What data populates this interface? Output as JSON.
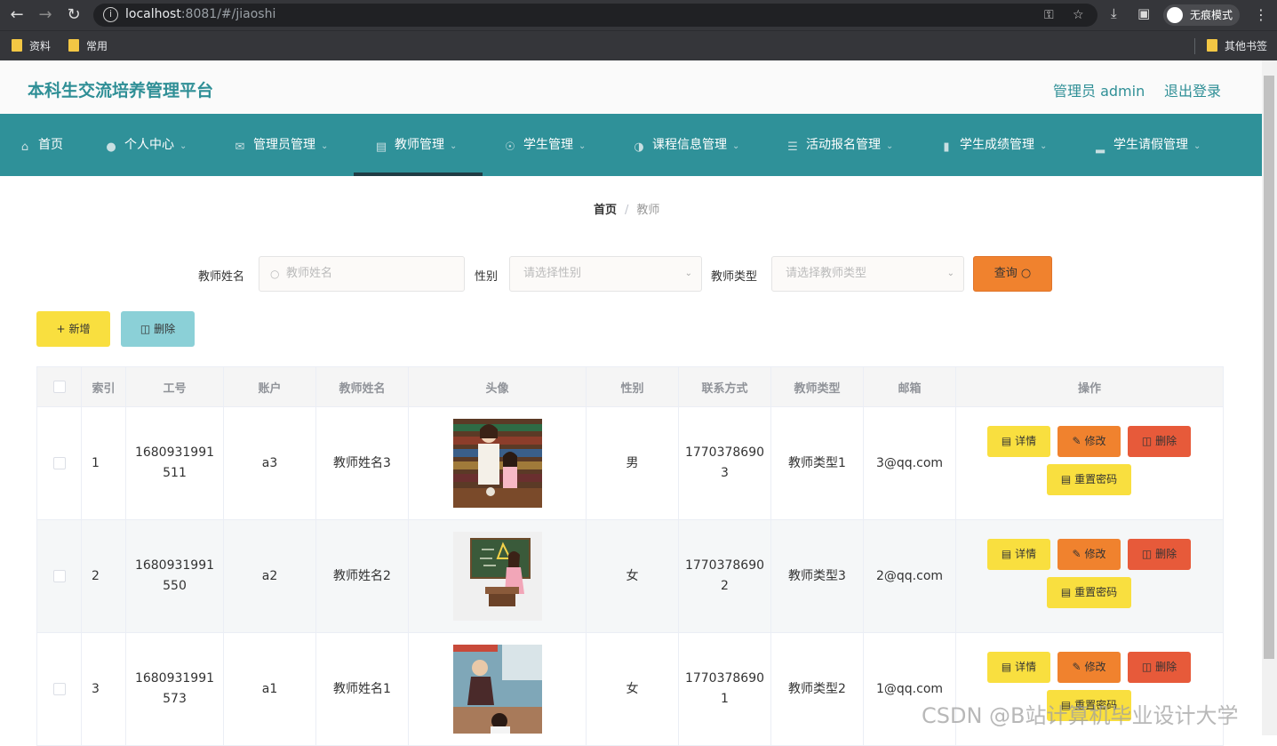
{
  "browser": {
    "url_host": "localhost",
    "url_rest": ":8081/#/jiaoshi",
    "incognito_label": "无痕模式",
    "bookmarks": [
      "资料",
      "常用"
    ],
    "other_bookmarks": "其他书签"
  },
  "header": {
    "title": "本科生交流培养管理平台",
    "admin": "管理员 admin",
    "logout": "退出登录"
  },
  "menu": [
    {
      "label": "首页",
      "icon": "home-icon"
    },
    {
      "label": "个人中心",
      "icon": "user-icon"
    },
    {
      "label": "管理员管理",
      "icon": "mail-icon"
    },
    {
      "label": "教师管理",
      "icon": "briefcase-icon"
    },
    {
      "label": "学生管理",
      "icon": "compass-icon"
    },
    {
      "label": "课程信息管理",
      "icon": "microphone-icon"
    },
    {
      "label": "活动报名管理",
      "icon": "list-icon"
    },
    {
      "label": "学生成绩管理",
      "icon": "chat-icon"
    },
    {
      "label": "学生请假管理",
      "icon": "bar-chart-icon"
    }
  ],
  "breadcrumb": {
    "home": "首页",
    "sep": "/",
    "current": "教师"
  },
  "search": {
    "name_label": "教师姓名",
    "name_placeholder": "教师姓名",
    "gender_label": "性别",
    "gender_placeholder": "请选择性别",
    "type_label": "教师类型",
    "type_placeholder": "请选择教师类型",
    "query_label": "查询"
  },
  "actions": {
    "add_label": "新增",
    "delete_label": "删除"
  },
  "table": {
    "headers": [
      "索引",
      "工号",
      "账户",
      "教师姓名",
      "头像",
      "性别",
      "联系方式",
      "教师类型",
      "邮箱",
      "操作"
    ],
    "rows": [
      {
        "index": "1",
        "id": "1680931991511",
        "id_l1": "1680931991",
        "id_l2": "511",
        "account": "a3",
        "name": "教师姓名3",
        "gender": "男",
        "phone_l1": "1770378690",
        "phone_l2": "3",
        "type": "教师类型1",
        "email": "3@qq.com"
      },
      {
        "index": "2",
        "id": "1680931991550",
        "id_l1": "1680931991",
        "id_l2": "550",
        "account": "a2",
        "name": "教师姓名2",
        "gender": "女",
        "phone_l1": "1770378690",
        "phone_l2": "2",
        "type": "教师类型3",
        "email": "2@qq.com"
      },
      {
        "index": "3",
        "id": "1680931991573",
        "id_l1": "1680931991",
        "id_l2": "573",
        "account": "a1",
        "name": "教师姓名1",
        "gender": "女",
        "phone_l1": "1770378690",
        "phone_l2": "1",
        "type": "教师类型2",
        "email": "1@qq.com"
      }
    ],
    "ops": {
      "detail": "详情",
      "edit": "修改",
      "remove": "删除",
      "reset": "重置密码"
    }
  },
  "watermark": "CSDN @B站计算机毕业设计大学",
  "colors": {
    "primary": "#2f9199",
    "accent_yellow": "#f9df3f",
    "accent_orange": "#f0822e",
    "danger": "#e75a3a",
    "cyan": "#8bd0d7"
  }
}
